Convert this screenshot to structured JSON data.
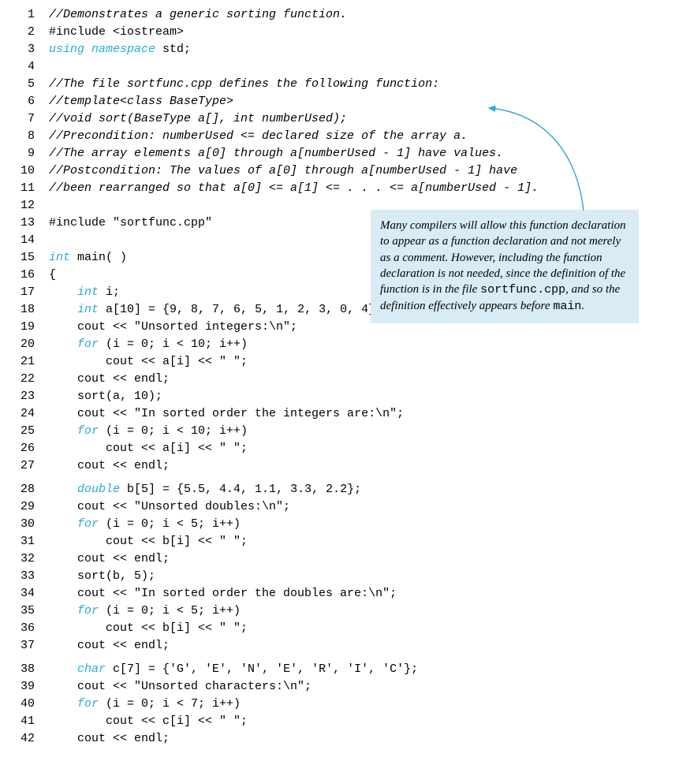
{
  "callout": {
    "t1": "Many compilers will allow this function declaration to appear as a function declaration and not merely as a comment. However, including the function declaration is not needed, since the definition of the function is in the file ",
    "mono1": "sortfunc.cpp",
    "t2": ", and so the definition effectively appears before ",
    "mono2": "main",
    "t3": "."
  },
  "lines": [
    {
      "n": "1",
      "seg": [
        {
          "c": "cmt",
          "t": "//Demonstrates a generic sorting function."
        }
      ]
    },
    {
      "n": "2",
      "seg": [
        {
          "t": "#include <iostream>"
        }
      ]
    },
    {
      "n": "3",
      "seg": [
        {
          "c": "kw",
          "t": "using namespace"
        },
        {
          "t": " std;"
        }
      ]
    },
    {
      "n": "4",
      "seg": [
        {
          "t": ""
        }
      ]
    },
    {
      "n": "5",
      "seg": [
        {
          "c": "cmt",
          "t": "//The file sortfunc.cpp defines the following function:"
        }
      ]
    },
    {
      "n": "6",
      "seg": [
        {
          "c": "cmt",
          "t": "//template<class BaseType>"
        }
      ]
    },
    {
      "n": "7",
      "seg": [
        {
          "c": "cmt",
          "t": "//void sort(BaseType a[], int numberUsed);"
        }
      ]
    },
    {
      "n": "8",
      "seg": [
        {
          "c": "cmt",
          "t": "//Precondition: numberUsed <= declared size of the array a."
        }
      ]
    },
    {
      "n": "9",
      "seg": [
        {
          "c": "cmt",
          "t": "//The array elements a[0] through a[numberUsed - 1] have values."
        }
      ]
    },
    {
      "n": "10",
      "seg": [
        {
          "c": "cmt",
          "t": "//Postcondition: The values of a[0] through a[numberUsed - 1] have"
        }
      ]
    },
    {
      "n": "11",
      "seg": [
        {
          "c": "cmt",
          "t": "//been rearranged so that a[0] <= a[1] <= . . . <= a[numberUsed - 1]."
        }
      ]
    },
    {
      "n": "12",
      "seg": [
        {
          "t": ""
        }
      ]
    },
    {
      "n": "13",
      "seg": [
        {
          "t": "#include \"sortfunc.cpp\""
        }
      ]
    },
    {
      "n": "14",
      "seg": [
        {
          "t": ""
        }
      ]
    },
    {
      "n": "15",
      "seg": [
        {
          "c": "kw",
          "t": "int"
        },
        {
          "t": " main( )"
        }
      ]
    },
    {
      "n": "16",
      "seg": [
        {
          "t": "{"
        }
      ]
    },
    {
      "n": "17",
      "seg": [
        {
          "t": "    "
        },
        {
          "c": "kw",
          "t": "int"
        },
        {
          "t": " i;"
        }
      ]
    },
    {
      "n": "18",
      "seg": [
        {
          "t": "    "
        },
        {
          "c": "kw",
          "t": "int"
        },
        {
          "t": " a[10] = {9, 8, 7, 6, 5, 1, 2, 3, 0, 4};"
        }
      ]
    },
    {
      "n": "19",
      "seg": [
        {
          "t": "    cout << \"Unsorted integers:\\n\";"
        }
      ]
    },
    {
      "n": "20",
      "seg": [
        {
          "t": "    "
        },
        {
          "c": "kw",
          "t": "for"
        },
        {
          "t": " (i = 0; i < 10; i++)"
        }
      ]
    },
    {
      "n": "21",
      "seg": [
        {
          "t": "        cout << a[i] << \" \";"
        }
      ]
    },
    {
      "n": "22",
      "seg": [
        {
          "t": "    cout << endl;"
        }
      ]
    },
    {
      "n": "23",
      "seg": [
        {
          "t": "    sort(a, 10);"
        }
      ]
    },
    {
      "n": "24",
      "seg": [
        {
          "t": "    cout << \"In sorted order the integers are:\\n\";"
        }
      ]
    },
    {
      "n": "25",
      "seg": [
        {
          "t": "    "
        },
        {
          "c": "kw",
          "t": "for"
        },
        {
          "t": " (i = 0; i < 10; i++)"
        }
      ]
    },
    {
      "n": "26",
      "seg": [
        {
          "t": "        cout << a[i] << \" \";"
        }
      ]
    },
    {
      "n": "27",
      "seg": [
        {
          "t": "    cout << endl;"
        }
      ]
    },
    {
      "gap": true
    },
    {
      "n": "28",
      "seg": [
        {
          "t": "    "
        },
        {
          "c": "kw",
          "t": "double"
        },
        {
          "t": " b[5] = {5.5, 4.4, 1.1, 3.3, 2.2};"
        }
      ]
    },
    {
      "n": "29",
      "seg": [
        {
          "t": "    cout << \"Unsorted doubles:\\n\";"
        }
      ]
    },
    {
      "n": "30",
      "seg": [
        {
          "t": "    "
        },
        {
          "c": "kw",
          "t": "for"
        },
        {
          "t": " (i = 0; i < 5; i++)"
        }
      ]
    },
    {
      "n": "31",
      "seg": [
        {
          "t": "        cout << b[i] << \" \";"
        }
      ]
    },
    {
      "n": "32",
      "seg": [
        {
          "t": "    cout << endl;"
        }
      ]
    },
    {
      "n": "33",
      "seg": [
        {
          "t": "    sort(b, 5);"
        }
      ]
    },
    {
      "n": "34",
      "seg": [
        {
          "t": "    cout << \"In sorted order the doubles are:\\n\";"
        }
      ]
    },
    {
      "n": "35",
      "seg": [
        {
          "t": "    "
        },
        {
          "c": "kw",
          "t": "for"
        },
        {
          "t": " (i = 0; i < 5; i++)"
        }
      ]
    },
    {
      "n": "36",
      "seg": [
        {
          "t": "        cout << b[i] << \" \";"
        }
      ]
    },
    {
      "n": "37",
      "seg": [
        {
          "t": "    cout << endl;"
        }
      ]
    },
    {
      "gap": true
    },
    {
      "n": "38",
      "seg": [
        {
          "t": "    "
        },
        {
          "c": "kw",
          "t": "char"
        },
        {
          "t": " c[7] = {'G', 'E', 'N', 'E', 'R', 'I', 'C'};"
        }
      ]
    },
    {
      "n": "39",
      "seg": [
        {
          "t": "    cout << \"Unsorted characters:\\n\";"
        }
      ]
    },
    {
      "n": "40",
      "seg": [
        {
          "t": "    "
        },
        {
          "c": "kw",
          "t": "for"
        },
        {
          "t": " (i = 0; i < 7; i++)"
        }
      ]
    },
    {
      "n": "41",
      "seg": [
        {
          "t": "        cout << c[i] << \" \";"
        }
      ]
    },
    {
      "n": "42",
      "seg": [
        {
          "t": "    cout << endl;"
        }
      ]
    }
  ]
}
